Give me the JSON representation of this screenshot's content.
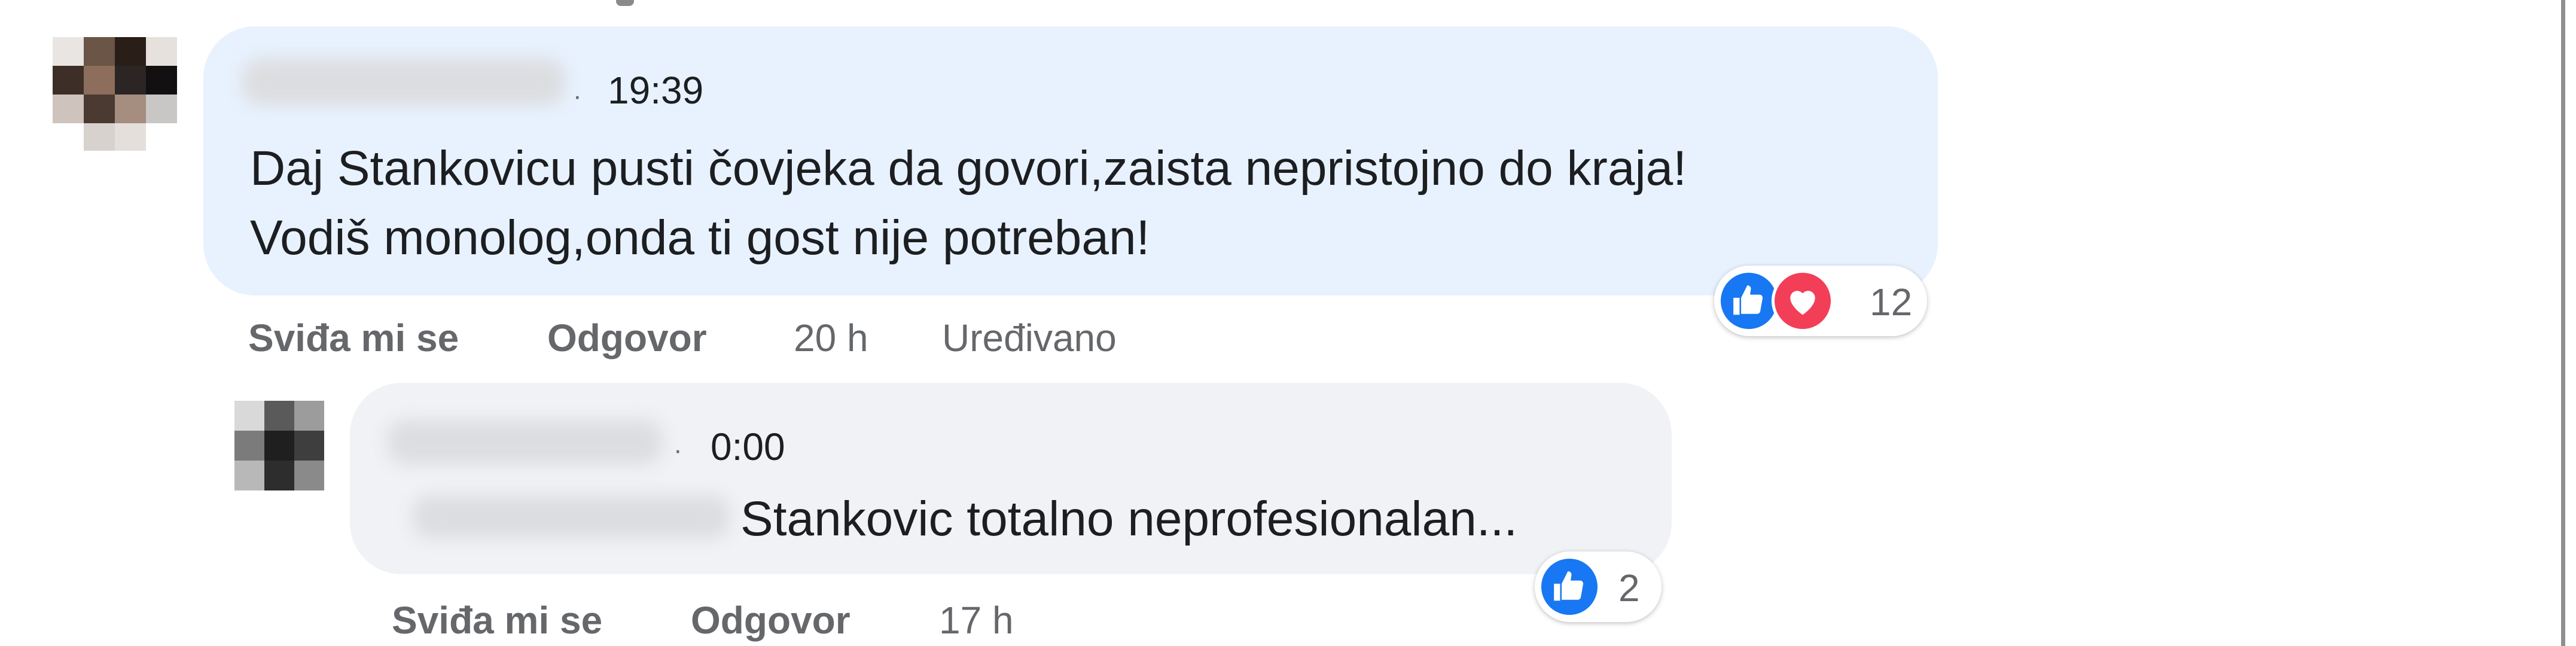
{
  "comment": {
    "time": "19:39",
    "text_line1": "Daj Stankovicu pusti čovjeka da govori,zaista nepristojno do kraja!",
    "text_line2": "Vodiš monolog,onda ti gost nije potreban!",
    "reactions": {
      "icons": [
        "like-icon",
        "love-icon"
      ],
      "count": "12"
    },
    "actions": {
      "like": "Sviđa mi se",
      "reply": "Odgovor",
      "age": "20 h",
      "edited": "Uređivano"
    }
  },
  "reply": {
    "time": "0:00",
    "text": "Stankovic totalno neprofesionalan...",
    "reactions": {
      "icons": [
        "like-icon"
      ],
      "count": "2"
    },
    "actions": {
      "like": "Sviđa mi se",
      "reply": "Odgovor",
      "age": "17 h"
    }
  },
  "colors": {
    "like_blue": "#1877f2",
    "love_red": "#f33e58",
    "comment_bubble": "#e8f2fe",
    "reply_bubble": "#f0f2f5"
  }
}
